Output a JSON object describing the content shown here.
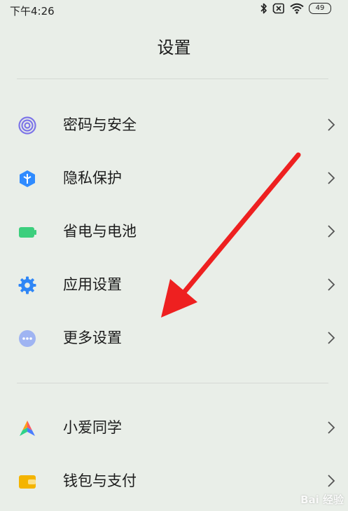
{
  "status_bar": {
    "time": "下午4:26",
    "battery_level": "49",
    "icons": [
      "bluetooth-icon",
      "sim-off-icon",
      "wifi-icon",
      "battery-icon"
    ]
  },
  "page": {
    "title": "设置"
  },
  "groups": [
    {
      "items": [
        {
          "label": "密码与安全",
          "icon": "fingerprint-icon",
          "color": "#7d75e8"
        },
        {
          "label": "隐私保护",
          "icon": "privacy-shield-icon",
          "color": "#2f8bff"
        },
        {
          "label": "省电与电池",
          "icon": "battery-green-icon",
          "color": "#3ccf7d"
        },
        {
          "label": "应用设置",
          "icon": "gear-icon",
          "color": "#2f86f6"
        },
        {
          "label": "更多设置",
          "icon": "more-dots-icon",
          "color": "#9fb4f2"
        }
      ]
    },
    {
      "items": [
        {
          "label": "小爱同学",
          "icon": "xiaoai-icon",
          "color": "#4a7dff"
        },
        {
          "label": "钱包与支付",
          "icon": "wallet-icon",
          "color": "#f4b400"
        }
      ]
    }
  ],
  "annotation": {
    "arrow_color": "#ee2020"
  },
  "watermark": {
    "text": "Bai 经验"
  }
}
